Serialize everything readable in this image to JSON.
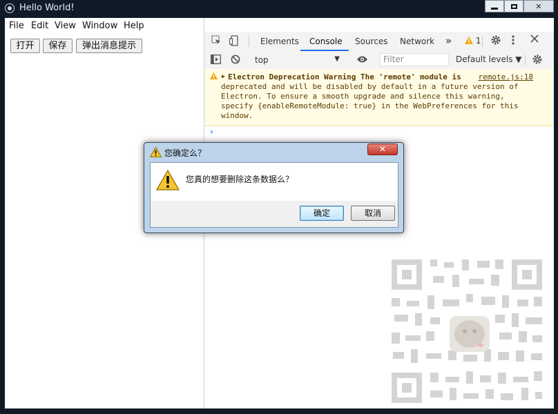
{
  "window": {
    "title": "Hello World!",
    "min_label": "",
    "max_label": "",
    "close_label": "✕"
  },
  "menu": {
    "items": [
      "File",
      "Edit",
      "View",
      "Window",
      "Help"
    ]
  },
  "app": {
    "buttons": [
      "打开",
      "保存",
      "弹出消息提示"
    ]
  },
  "devtools": {
    "tabs": [
      "Elements",
      "Console",
      "Sources",
      "Network"
    ],
    "active_tab": "Console",
    "more_label": "»",
    "warning_count": "1",
    "context": "top",
    "filter_placeholder": "Filter",
    "levels_label": "Default levels ▼",
    "message": {
      "lines": [
        "Electron Deprecation Warning The 'remote' module is",
        "deprecated and will be disabled by default in a future version of",
        "Electron. To ensure a smooth upgrade and silence this warning,",
        "specify {enableRemoteModule: true} in the WebPreferences for this",
        "window."
      ],
      "source": "remote.js:18"
    },
    "prompt": "›"
  },
  "dialog": {
    "title": "您确定么？",
    "message": "您真的想要删除这条数据么？",
    "ok_label": "确定",
    "cancel_label": "取消",
    "close_label": "✕"
  },
  "colors": {
    "accent": "#1a73e8",
    "warning_bg": "#fffbe5",
    "warning_icon": "#f2a600"
  }
}
